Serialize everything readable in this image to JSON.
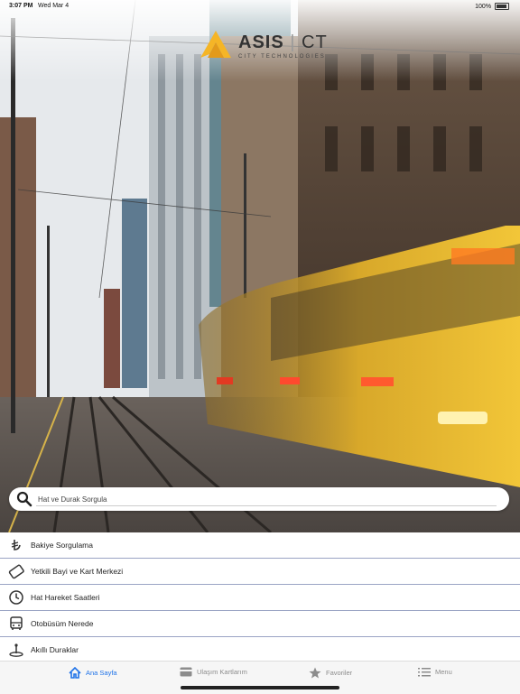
{
  "status_bar": {
    "time": "3:07 PM",
    "date": "Wed Mar 4",
    "battery": "100%"
  },
  "logo": {
    "name_bold": "ASIS",
    "name_rest": "CT",
    "tagline": "CITY TECHNOLOGIES"
  },
  "search": {
    "placeholder": "Hat ve Durak Sorgula"
  },
  "menu": {
    "items": [
      {
        "label": "Bakiye Sorgulama",
        "icon": "lira-icon"
      },
      {
        "label": "Yetkili Bayi ve Kart Merkezi",
        "icon": "card-icon"
      },
      {
        "label": "Hat Hareket Saatleri",
        "icon": "clock-icon"
      },
      {
        "label": "Otobüsüm Nerede",
        "icon": "bus-icon"
      },
      {
        "label": "Akıllı Duraklar",
        "icon": "smart-stop-icon"
      }
    ]
  },
  "tabs": [
    {
      "label": "Ana Sayfa",
      "icon": "home-icon",
      "active": true
    },
    {
      "label": "Ulaşım Kartlarım",
      "icon": "card-icon",
      "active": false
    },
    {
      "label": "Favoriler",
      "icon": "star-icon",
      "active": false
    },
    {
      "label": "Menu",
      "icon": "list-icon",
      "active": false
    }
  ],
  "colors": {
    "accent": "#1f73e8",
    "logo_yellow": "#f5b526",
    "divider": "#9aa4c4"
  }
}
